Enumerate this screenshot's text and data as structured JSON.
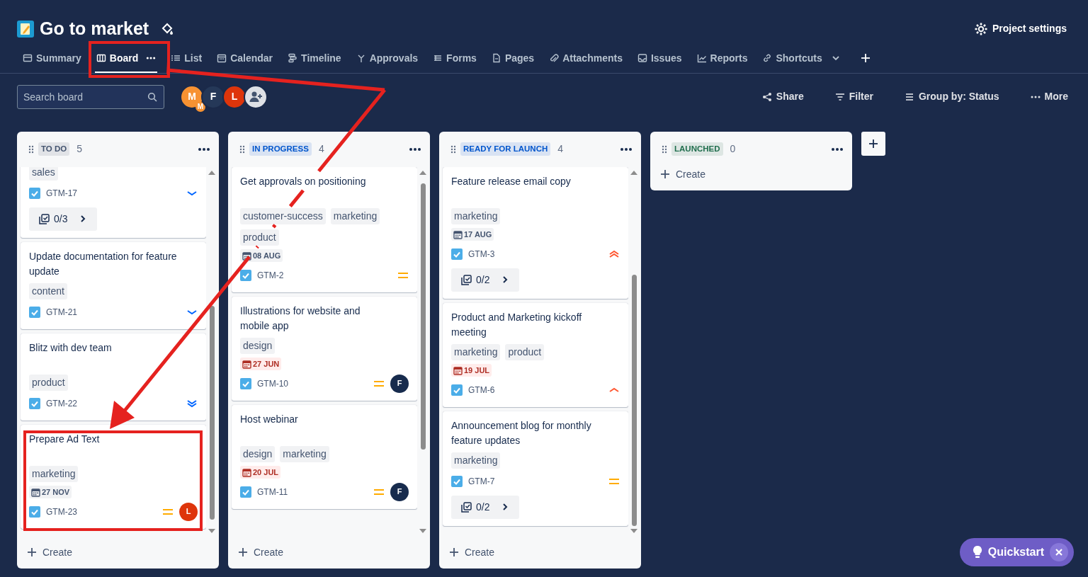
{
  "project": {
    "title": "Go to market"
  },
  "header_action": {
    "label": "Project settings"
  },
  "tabs": [
    {
      "label": "Summary",
      "selected": false
    },
    {
      "label": "Board",
      "selected": true
    },
    {
      "label": "List",
      "selected": false
    },
    {
      "label": "Calendar",
      "selected": false
    },
    {
      "label": "Timeline",
      "selected": false
    },
    {
      "label": "Approvals",
      "selected": false
    },
    {
      "label": "Forms",
      "selected": false
    },
    {
      "label": "Pages",
      "selected": false
    },
    {
      "label": "Attachments",
      "selected": false
    },
    {
      "label": "Issues",
      "selected": false
    },
    {
      "label": "Reports",
      "selected": false
    },
    {
      "label": "Shortcuts",
      "selected": false
    }
  ],
  "search": {
    "placeholder": "Search board"
  },
  "avatars": [
    {
      "initial": "M",
      "color": "#f79232",
      "badge": "M"
    },
    {
      "initial": "F",
      "color": "#253858"
    },
    {
      "initial": "L",
      "color": "#de350b"
    }
  ],
  "toolbar": [
    "Share",
    "Filter",
    "Group by: Status",
    "More"
  ],
  "columns": [
    {
      "status": "TO DO",
      "color": "#44546f",
      "count": "5",
      "create": "Create",
      "cards": [
        {
          "tags": [
            "sales"
          ],
          "key": "GTM-17",
          "priority": {
            "kind": "low"
          },
          "subtasks": "0/3"
        },
        {
          "title": "Update documentation for feature update",
          "tags": [
            "content"
          ],
          "key": "GTM-21",
          "priority": {
            "kind": "low"
          }
        },
        {
          "title": "Blitz with dev team",
          "tags": [
            "product"
          ],
          "key": "GTM-22",
          "priority": {
            "kind": "lowest"
          }
        },
        {
          "title": "Prepare Ad Text",
          "tags": [
            "marketing"
          ],
          "due": {
            "text": "27 NOV",
            "overdue": false
          },
          "key": "GTM-23",
          "priority": {
            "kind": "medium"
          },
          "assignee": {
            "initial": "L",
            "color": "#de350b"
          }
        }
      ]
    },
    {
      "status": "IN PROGRESS",
      "color": "#0055cc",
      "count": "4",
      "create": "Create",
      "cards": [
        {
          "title": "Get approvals on positioning",
          "tags": [
            "customer-success",
            "marketing",
            "product"
          ],
          "due": {
            "text": "08 AUG",
            "overdue": false
          },
          "key": "GTM-2",
          "priority": {
            "kind": "medium"
          }
        },
        {
          "title": "Illustrations for website and mobile app",
          "tags": [
            "design"
          ],
          "due": {
            "text": "27 JUN",
            "overdue": true
          },
          "key": "GTM-10",
          "priority": {
            "kind": "medium"
          },
          "assignee": {
            "initial": "F",
            "color": "#172b4d"
          }
        },
        {
          "title": "Host webinar",
          "tags": [
            "design",
            "marketing"
          ],
          "due": {
            "text": "20 JUL",
            "overdue": true
          },
          "key": "GTM-11",
          "priority": {
            "kind": "medium"
          },
          "assignee": {
            "initial": "F",
            "color": "#172b4d"
          }
        }
      ]
    },
    {
      "status": "READY FOR LAUNCH",
      "color": "#0055cc",
      "count": "4",
      "create": "Create",
      "cards": [
        {
          "title": "Feature release email copy",
          "tags": [
            "marketing"
          ],
          "due": {
            "text": "17 AUG",
            "overdue": false
          },
          "key": "GTM-3",
          "priority": {
            "kind": "highest"
          },
          "subtasks": "0/2"
        },
        {
          "title": "Product and Marketing kickoff meeting",
          "tags": [
            "marketing",
            "product"
          ],
          "due": {
            "text": "19 JUL",
            "overdue": true
          },
          "key": "GTM-6",
          "priority": {
            "kind": "high"
          }
        },
        {
          "title": "Announcement blog for monthly feature updates",
          "tags": [
            "marketing"
          ],
          "key": "GTM-7",
          "priority": {
            "kind": "medium"
          },
          "subtasks": "0/2"
        }
      ]
    },
    {
      "status": "LAUNCHED",
      "color": "#216e4e",
      "count": "0",
      "create": "Create"
    }
  ],
  "quickstart": {
    "label": "Quickstart"
  }
}
